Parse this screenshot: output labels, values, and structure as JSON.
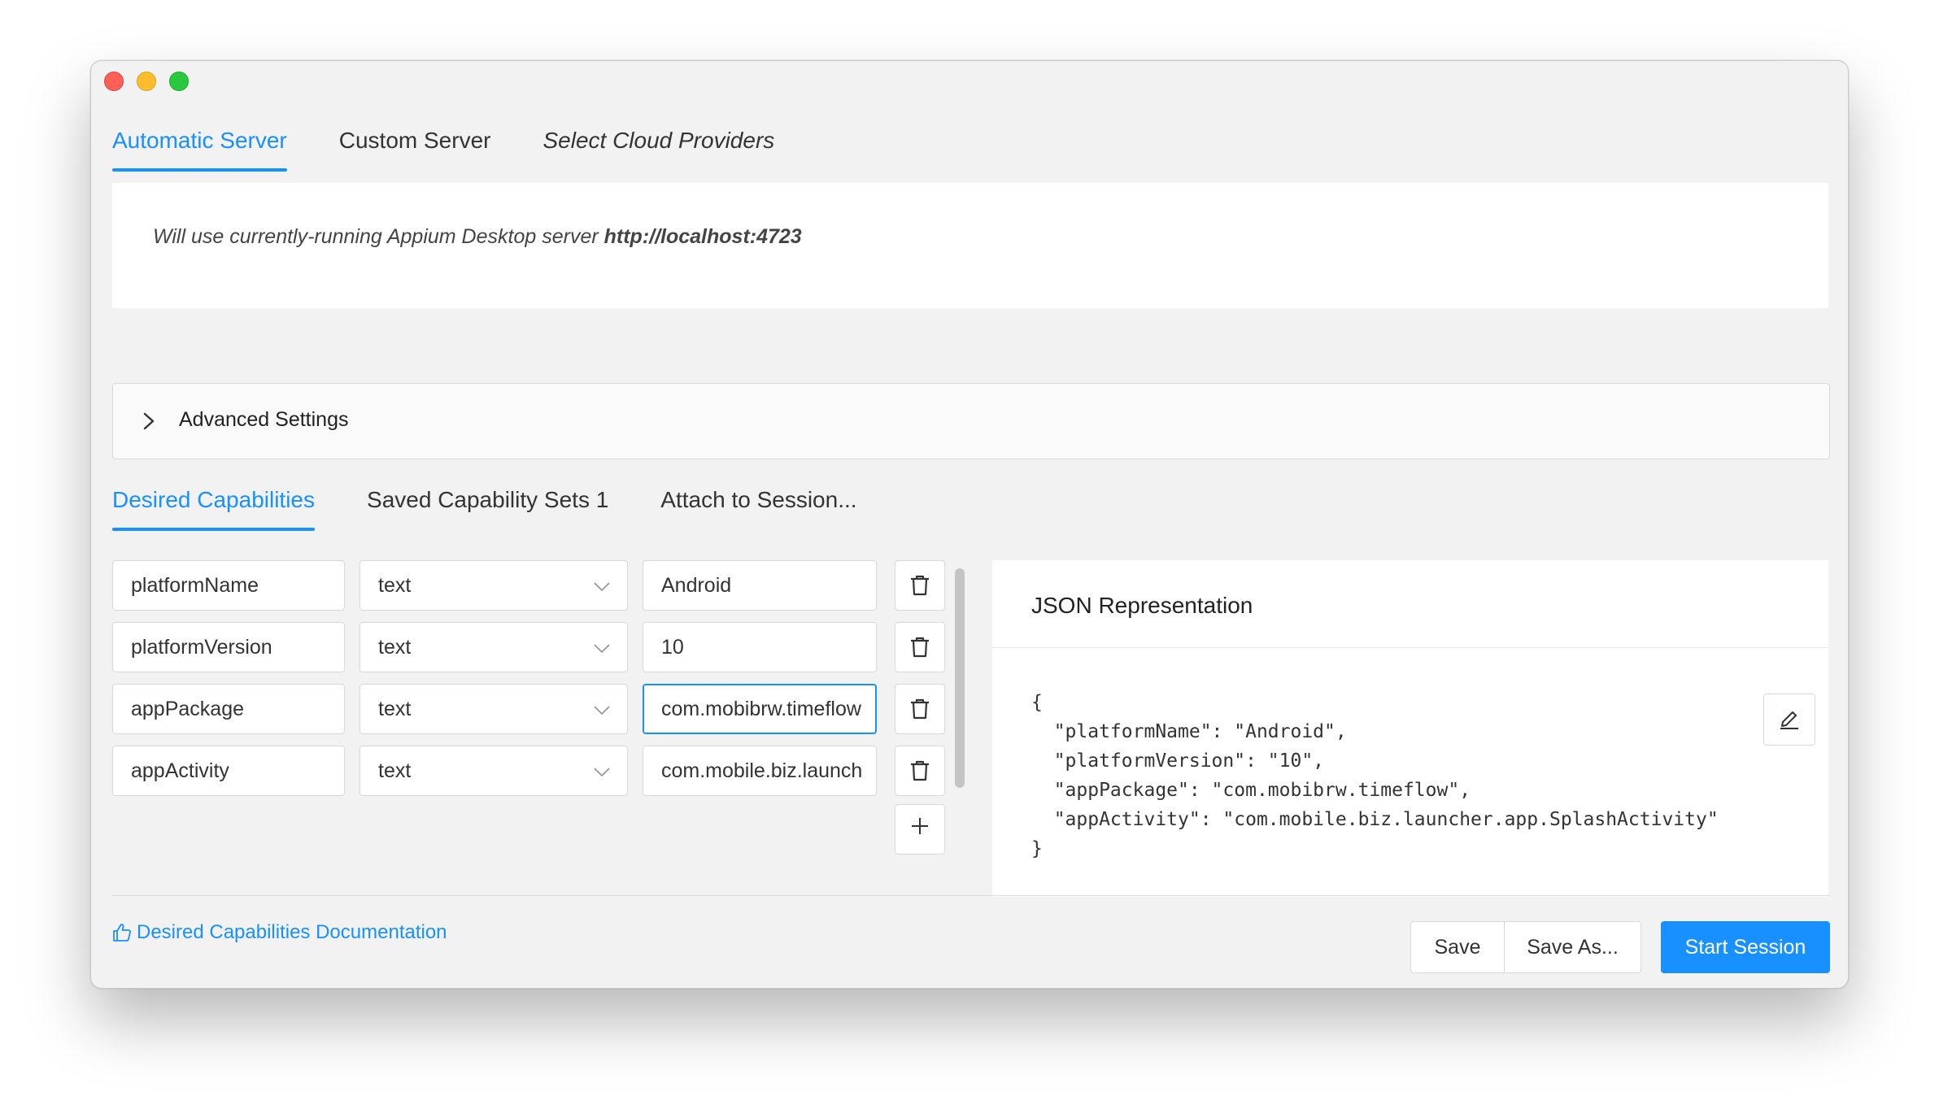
{
  "window": {
    "traffic_lights": [
      "close",
      "minimize",
      "zoom"
    ]
  },
  "server_tabs": [
    {
      "label": "Automatic Server",
      "active": true
    },
    {
      "label": "Custom Server",
      "active": false
    },
    {
      "label": "Select Cloud Providers",
      "active": false
    }
  ],
  "server_message": {
    "text": "Will use currently-running Appium Desktop server ",
    "url": "http://localhost:4723"
  },
  "advanced_settings": {
    "label": "Advanced Settings"
  },
  "cap_tabs": [
    {
      "label": "Desired Capabilities",
      "active": true
    },
    {
      "label": "Saved Capability Sets 1",
      "active": false
    },
    {
      "label": "Attach to Session...",
      "active": false
    }
  ],
  "capabilities": [
    {
      "name": "platformName",
      "type": "text",
      "value": "Android"
    },
    {
      "name": "platformVersion",
      "type": "text",
      "value": "10"
    },
    {
      "name": "appPackage",
      "type": "text",
      "value": "com.mobibrw.timeflow"
    },
    {
      "name": "appActivity",
      "type": "text",
      "value": "com.mobile.biz.launch"
    }
  ],
  "json_panel": {
    "title": "JSON Representation",
    "body": "{\n  \"platformName\": \"Android\",\n  \"platformVersion\": \"10\",\n  \"appPackage\": \"com.mobibrw.timeflow\",\n  \"appActivity\": \"com.mobile.biz.launcher.app.SplashActivity\"\n}"
  },
  "footer": {
    "doc_link": "Desired Capabilities Documentation",
    "save_label": "Save",
    "save_as_label": "Save As...",
    "start_label": "Start Session"
  },
  "colors": {
    "accent": "#1890ff",
    "window_bg": "#f2f2f2",
    "close": "#fe5f57",
    "minimize": "#febc2e",
    "zoom": "#28c840"
  },
  "icons": [
    "chevron-right-icon",
    "chevron-down-icon",
    "trash-icon",
    "plus-icon",
    "edit-icon",
    "like-icon"
  ]
}
